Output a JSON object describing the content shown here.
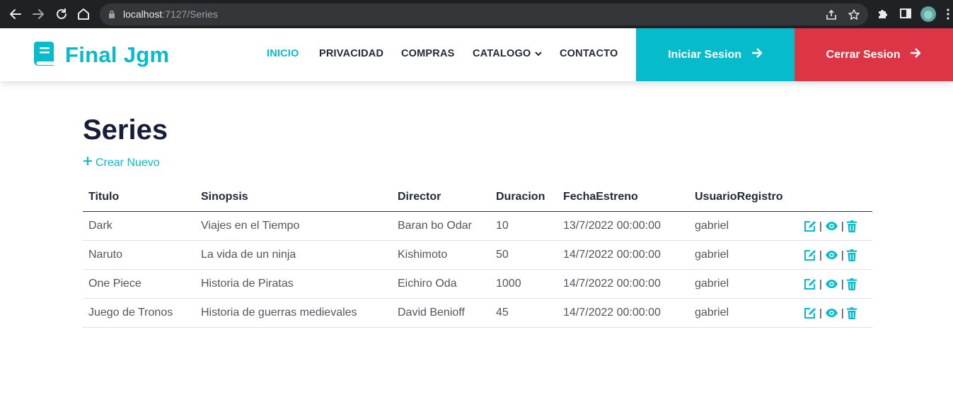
{
  "browser": {
    "url_host": "localhost",
    "url_path": ":7127/Series"
  },
  "header": {
    "brand": "Final Jgm",
    "nav": [
      {
        "label": "INICIO",
        "active": true
      },
      {
        "label": "PRIVACIDAD",
        "active": false
      },
      {
        "label": "COMPRAS",
        "active": false
      },
      {
        "label": "CATALOGO",
        "active": false,
        "dropdown": true
      },
      {
        "label": "CONTACTO",
        "active": false
      }
    ],
    "login_label": "Iniciar Sesion",
    "logout_label": "Cerrar Sesion"
  },
  "main": {
    "title": "Series",
    "create_label": "Crear Nuevo",
    "columns": [
      "Titulo",
      "Sinopsis",
      "Director",
      "Duracion",
      "FechaEstreno",
      "UsuarioRegistro"
    ],
    "rows": [
      {
        "titulo": "Dark",
        "sinopsis": "Viajes en el Tiempo",
        "director": "Baran bo Odar",
        "duracion": "10",
        "fecha": "13/7/2022 00:00:00",
        "usuario": "gabriel"
      },
      {
        "titulo": "Naruto",
        "sinopsis": "La vida de un ninja",
        "director": "Kishimoto",
        "duracion": "50",
        "fecha": "14/7/2022 00:00:00",
        "usuario": "gabriel"
      },
      {
        "titulo": "One Piece",
        "sinopsis": "Historia de Piratas",
        "director": "Eichiro Oda",
        "duracion": "1000",
        "fecha": "14/7/2022 00:00:00",
        "usuario": "gabriel"
      },
      {
        "titulo": "Juego de Tronos",
        "sinopsis": "Historia de guerras medievales",
        "director": "David Benioff",
        "duracion": "45",
        "fecha": "14/7/2022 00:00:00",
        "usuario": "gabriel"
      }
    ],
    "action_separator": "|",
    "action_icons": [
      "edit-icon",
      "eye-icon",
      "trash-icon"
    ]
  },
  "colors": {
    "accent": "#06bbcc",
    "danger": "#dc3545",
    "heading": "#181d38"
  }
}
